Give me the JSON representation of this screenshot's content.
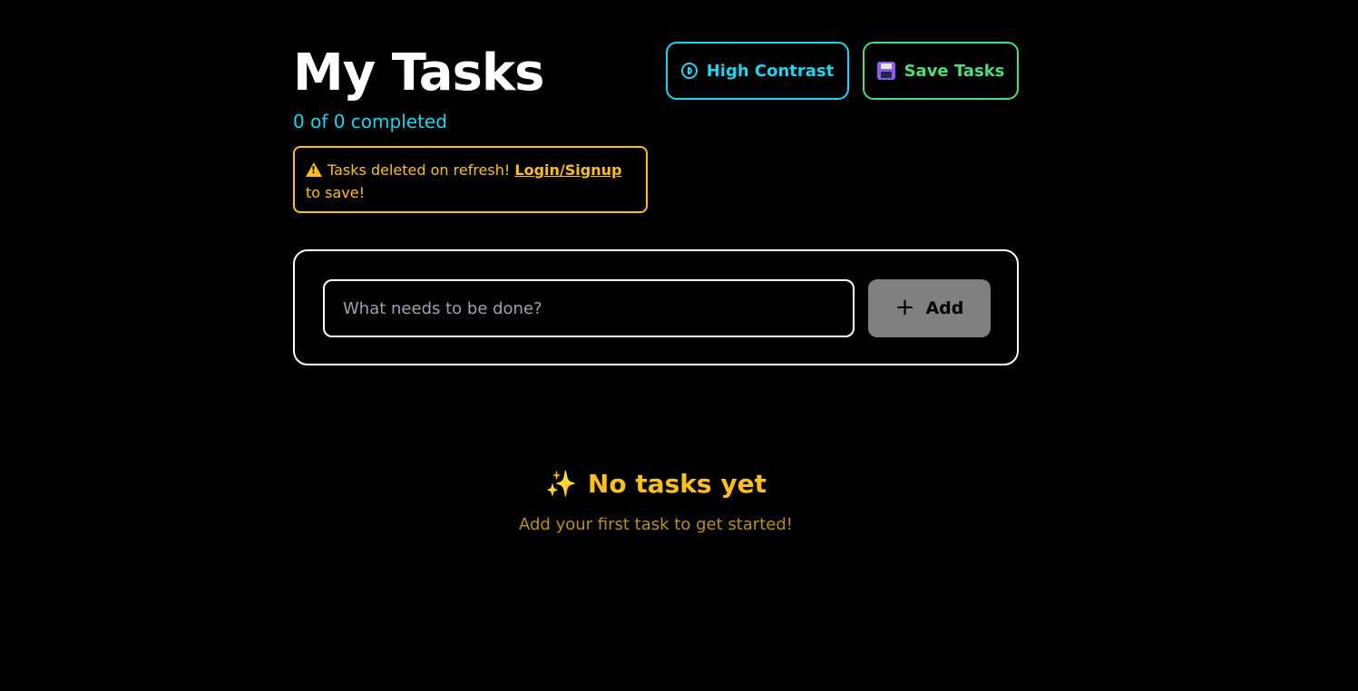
{
  "header": {
    "title": "My Tasks",
    "progress_text": "0 of 0 completed",
    "contrast_button_label": "High Contrast",
    "contrast_button_icon": "contrast-icon",
    "save_button_label": "Save Tasks",
    "save_button_icon": "floppy-disk-icon"
  },
  "warning": {
    "icon": "warning-icon",
    "text_before": "Tasks deleted on refresh!",
    "link_label": "Login/Signup",
    "text_after": "to save!"
  },
  "add_form": {
    "input_placeholder": "What needs to be done?",
    "input_value": "",
    "add_button_icon": "+",
    "add_button_label": "Add"
  },
  "empty_state": {
    "icon": "✨",
    "title": "No tasks yet",
    "subtitle": "Add your first task to get started!"
  },
  "colors": {
    "background": "#000000",
    "accent_cyan": "#22d3ee",
    "accent_green": "#4ade80",
    "warning_yellow": "#fbbf24",
    "add_button_gray": "#808080"
  }
}
